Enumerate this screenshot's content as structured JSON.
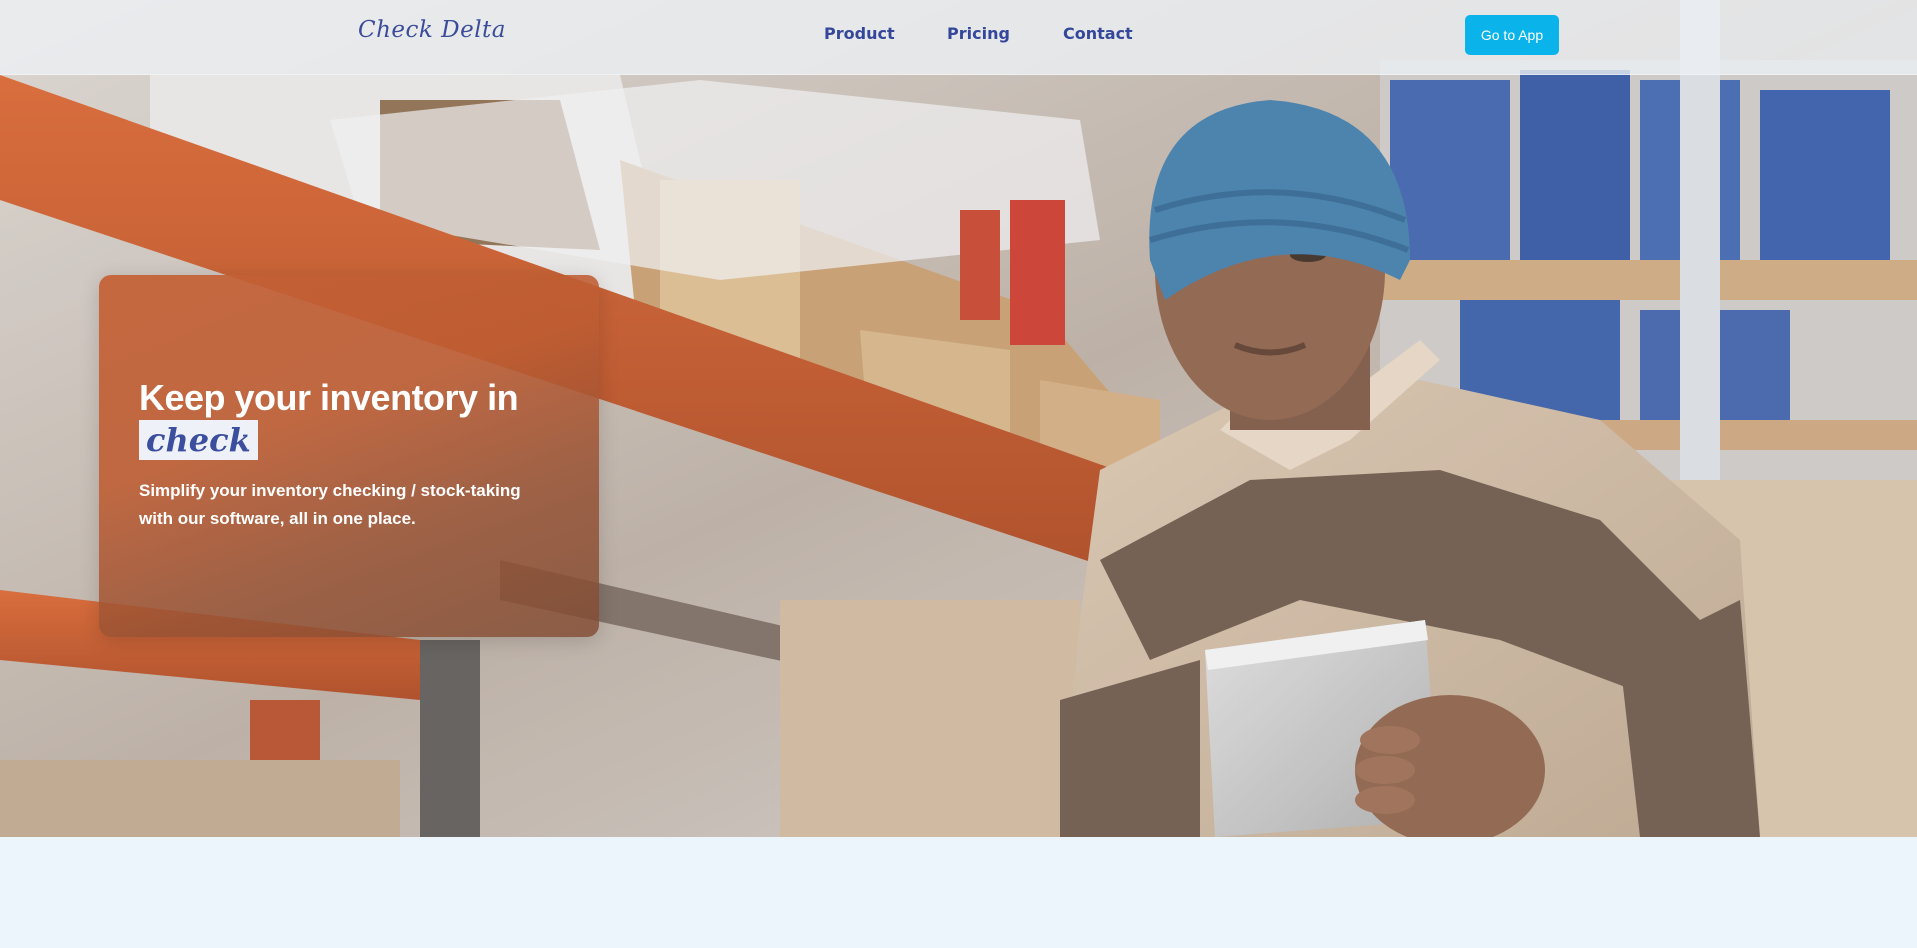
{
  "nav": {
    "logo": "Check Delta",
    "links": [
      {
        "label": "Product"
      },
      {
        "label": "Pricing"
      },
      {
        "label": "Contact"
      }
    ],
    "cta_label": "Go to App"
  },
  "hero": {
    "title_line1": "Keep your inventory in",
    "title_highlight": "check",
    "subtitle": "Simplify your inventory checking / stock-taking with our software, all in one place."
  },
  "colors": {
    "brand": "#3a4c9a",
    "cta": "#0ab4ea",
    "card": "#c2603a",
    "page_bg": "#ecf5fc"
  }
}
